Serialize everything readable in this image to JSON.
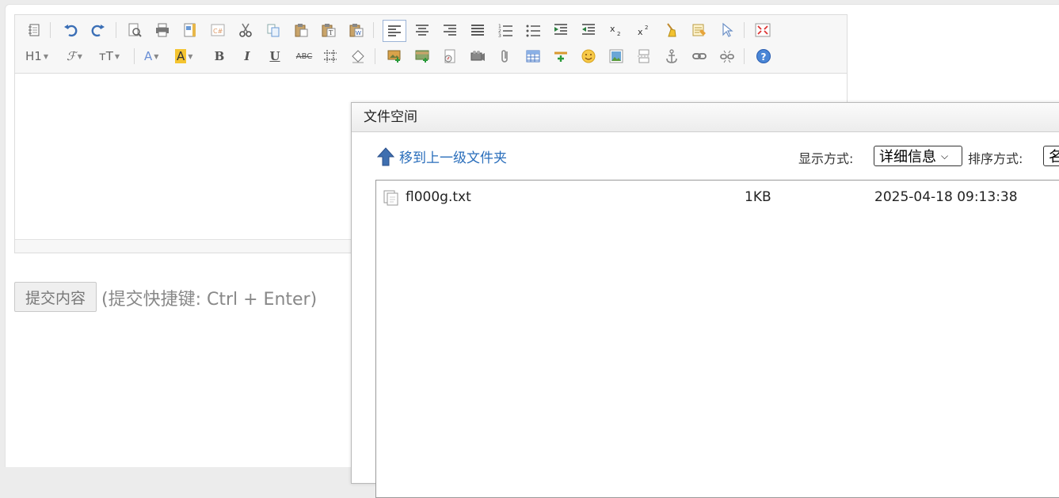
{
  "editor": {
    "submit_label": "提交内容",
    "shortcut_hint": "(提交快捷键: Ctrl + Enter)",
    "toolbar": {
      "heading_label": "H1",
      "font_label": "ℱ",
      "size_label": "тT",
      "forecolor_label": "A",
      "hilite_label": "A",
      "bold_label": "B",
      "italic_label": "I",
      "underline_label": "U",
      "strike_label": "ABC"
    }
  },
  "dialog": {
    "title": "文件空间",
    "parent_folder_label": "移到上一级文件夹",
    "view_mode_label": "显示方式:",
    "view_mode_value": "详细信息",
    "sort_label": "排序方式:",
    "sort_value": "名",
    "files": [
      {
        "name": "fl000g.txt",
        "size": "1KB",
        "modified": "2025-04-18 09:13:38"
      }
    ]
  },
  "colors": {
    "link": "#2a6ebb",
    "toolbar_bg": "#f7f7f7",
    "accent_blue": "#3b6fb6"
  }
}
